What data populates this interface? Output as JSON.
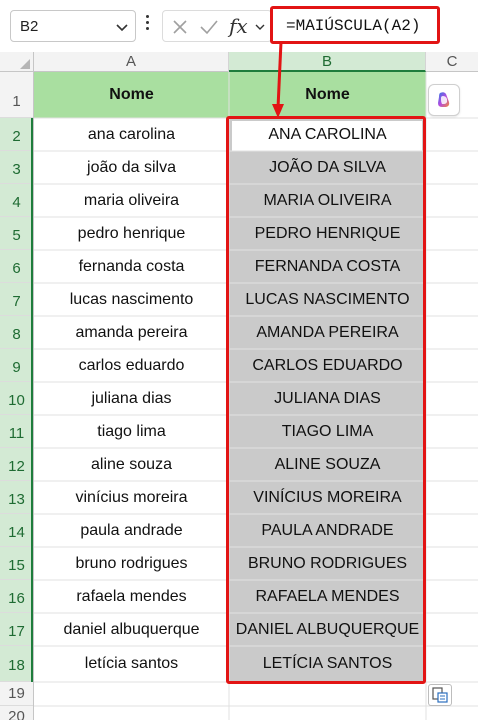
{
  "formula_bar": {
    "name_box": "B2",
    "fx_label": "fx",
    "formula": "=MAIÚSCULA(A2)"
  },
  "columns": [
    "A",
    "B",
    "C"
  ],
  "rows": [
    "1",
    "2",
    "3",
    "4",
    "5",
    "6",
    "7",
    "8",
    "9",
    "10",
    "11",
    "12",
    "13",
    "14",
    "15",
    "16",
    "17",
    "18",
    "19",
    "20"
  ],
  "header_row": {
    "col_a": "Nome",
    "col_b": "Nome"
  },
  "data_rows": [
    {
      "a": "ana carolina",
      "b": "ANA CAROLINA"
    },
    {
      "a": "joão da silva",
      "b": "JOÃO DA SILVA"
    },
    {
      "a": "maria oliveira",
      "b": "MARIA OLIVEIRA"
    },
    {
      "a": "pedro henrique",
      "b": "PEDRO HENRIQUE"
    },
    {
      "a": "fernanda costa",
      "b": "FERNANDA COSTA"
    },
    {
      "a": "lucas nascimento",
      "b": "LUCAS NASCIMENTO"
    },
    {
      "a": "amanda pereira",
      "b": "AMANDA PEREIRA"
    },
    {
      "a": "carlos eduardo",
      "b": "CARLOS EDUARDO"
    },
    {
      "a": "juliana dias",
      "b": "JULIANA DIAS"
    },
    {
      "a": "tiago lima",
      "b": "TIAGO LIMA"
    },
    {
      "a": "aline souza",
      "b": "ALINE SOUZA"
    },
    {
      "a": "vinícius moreira",
      "b": "VINÍCIUS MOREIRA"
    },
    {
      "a": "paula andrade",
      "b": "PAULA ANDRADE"
    },
    {
      "a": "bruno rodrigues",
      "b": "BRUNO RODRIGUES"
    },
    {
      "a": "rafaela mendes",
      "b": "RAFAELA MENDES"
    },
    {
      "a": "daniel albuquerque",
      "b": "DANIEL ALBUQUERQUE"
    },
    {
      "a": "letícia santos",
      "b": "LETÍCIA SANTOS"
    }
  ],
  "colors": {
    "header_fill": "#a9dfa0",
    "selection_fill": "#cacaca",
    "highlight_border": "#e21414",
    "excel_green": "#1e7d3c"
  },
  "icons": [
    "chevron-down-icon",
    "more-options-icon",
    "cancel-icon",
    "enter-icon",
    "copilot-icon",
    "paste-options-icon"
  ]
}
